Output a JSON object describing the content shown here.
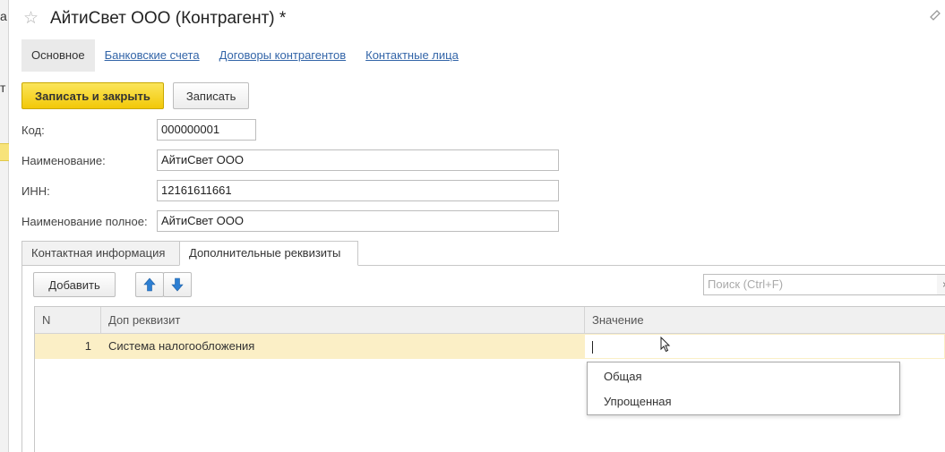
{
  "window": {
    "title": "АйтиСвет ООО (Контрагент) *"
  },
  "nav": {
    "tabs": [
      {
        "label": "Основное",
        "active": true
      },
      {
        "label": "Банковские счета",
        "active": false
      },
      {
        "label": "Договоры контрагентов",
        "active": false
      },
      {
        "label": "Контактные лица",
        "active": false
      }
    ]
  },
  "toolbar": {
    "save_close_label": "Записать и закрыть",
    "save_label": "Записать"
  },
  "fields": {
    "code": {
      "label": "Код:",
      "value": "000000001"
    },
    "name": {
      "label": "Наименование:",
      "value": "АйтиСвет ООО"
    },
    "inn": {
      "label": "ИНН:",
      "value": "12161611661"
    },
    "full_name": {
      "label": "Наименование полное:",
      "value": "АйтиСвет ООО"
    }
  },
  "sub_tabs": [
    {
      "label": "Контактная информация",
      "active": false
    },
    {
      "label": "Дополнительные реквизиты",
      "active": true
    }
  ],
  "panel": {
    "add_label": "Добавить",
    "search_placeholder": "Поиск (Ctrl+F)",
    "search_clear": "×"
  },
  "table": {
    "columns": [
      "N",
      "Доп реквизит",
      "Значение"
    ],
    "rows": [
      {
        "n": "1",
        "name": "Система налогообложения",
        "value": ""
      }
    ]
  },
  "dropdown": {
    "options": [
      "Общая",
      "Упрощенная"
    ]
  },
  "left_strip": {
    "fragments": [
      "а",
      "т"
    ]
  },
  "colors": {
    "primary_button": "#f2c808",
    "link": "#3365a8",
    "selected_row": "#fbefc6",
    "header_bg": "#f0f0f0",
    "arrow_blue": "#2d7fd3"
  }
}
